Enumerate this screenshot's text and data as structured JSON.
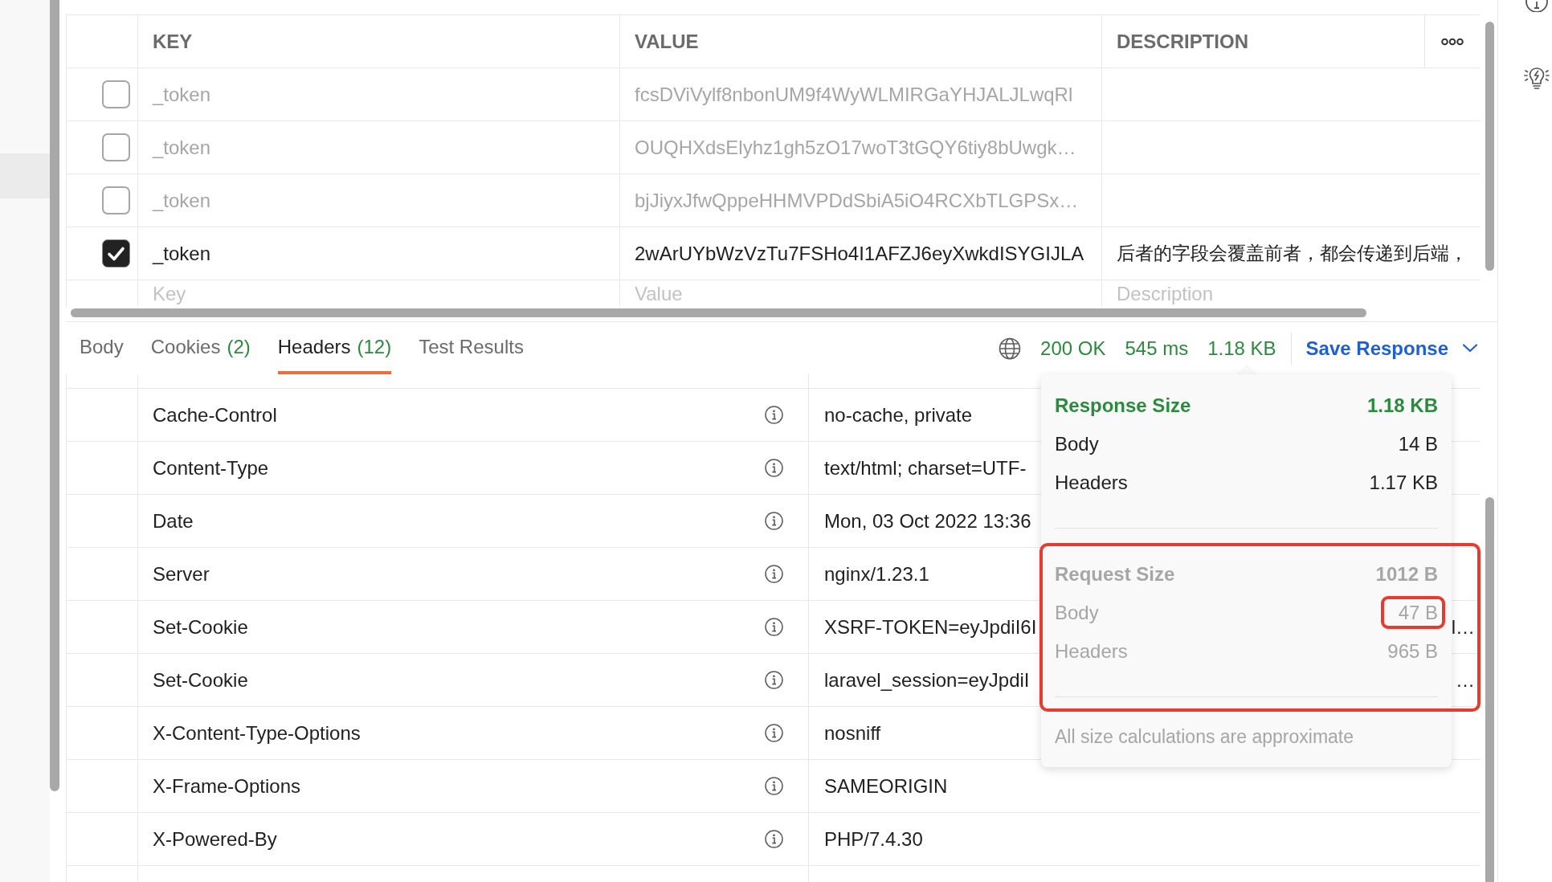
{
  "sidebar": {
    "items": [
      {
        "selected": true
      }
    ]
  },
  "params": {
    "columns": [
      "KEY",
      "VALUE",
      "DESCRIPTION"
    ],
    "rows": [
      {
        "checked": false,
        "key": "_token",
        "value": "fcsDViVylf8nbonUM9f4WyWLMIRGaYHJALJLwqRl"
      },
      {
        "checked": false,
        "key": "_token",
        "value": "OUQHXdsElyhz1gh5zO17woT3tGQY6tiy8bUwgk…"
      },
      {
        "checked": false,
        "key": "_token",
        "value": "bjJiyxJfwQppeHHMVPDdSbiA5iO4RCXbTLGPSx…"
      },
      {
        "checked": true,
        "key": "_token",
        "value": "2wArUYbWzVzTu7FSHo4I1AFZJ6eyXwkdISYGIJLA",
        "description": "后者的字段会覆盖前者，都会传递到后端，"
      }
    ],
    "new_row": {
      "key_placeholder": "Key",
      "value_placeholder": "Value",
      "description_placeholder": "Description"
    }
  },
  "response_tabs": [
    {
      "label": "Body",
      "selected": false
    },
    {
      "label": "Cookies",
      "count": "(2)",
      "selected": false
    },
    {
      "label": "Headers",
      "count": "(12)",
      "selected": true
    },
    {
      "label": "Test Results",
      "selected": false
    }
  ],
  "status": {
    "code": "200 OK",
    "time": "545 ms",
    "size": "1.18 KB"
  },
  "save_response": {
    "label": "Save Response"
  },
  "headers": [
    {
      "key": "Cache-Control",
      "value": "no-cache, private"
    },
    {
      "key": "Content-Type",
      "value": "text/html; charset=UTF-"
    },
    {
      "key": "Date",
      "value": "Mon, 03 Oct 2022 13:36"
    },
    {
      "key": "Server",
      "value": "nginx/1.23.1"
    },
    {
      "key": "Set-Cookie",
      "value": "XSRF-TOKEN=eyJpdiI6I",
      "tail": "l…"
    },
    {
      "key": "Set-Cookie",
      "value": "laravel_session=eyJpdiI",
      "tail": "…"
    },
    {
      "key": "X-Content-Type-Options",
      "value": "nosniff"
    },
    {
      "key": "X-Frame-Options",
      "value": "SAMEORIGIN"
    },
    {
      "key": "X-Powered-By",
      "value": "PHP/7.4.30"
    }
  ],
  "popover": {
    "sections": [
      {
        "title": "Response Size",
        "total": "1.18 KB",
        "dimmed": false,
        "highlighted": false,
        "rows": [
          {
            "label": "Body",
            "value": "14 B",
            "highlighted": false
          },
          {
            "label": "Headers",
            "value": "1.17 KB",
            "highlighted": false
          }
        ]
      },
      {
        "title": "Request Size",
        "total": "1012 B",
        "dimmed": true,
        "highlighted": true,
        "rows": [
          {
            "label": "Body",
            "value": "47 B",
            "highlighted": true
          },
          {
            "label": "Headers",
            "value": "965 B",
            "highlighted": false
          }
        ]
      }
    ],
    "note": "All size calculations are approximate"
  }
}
